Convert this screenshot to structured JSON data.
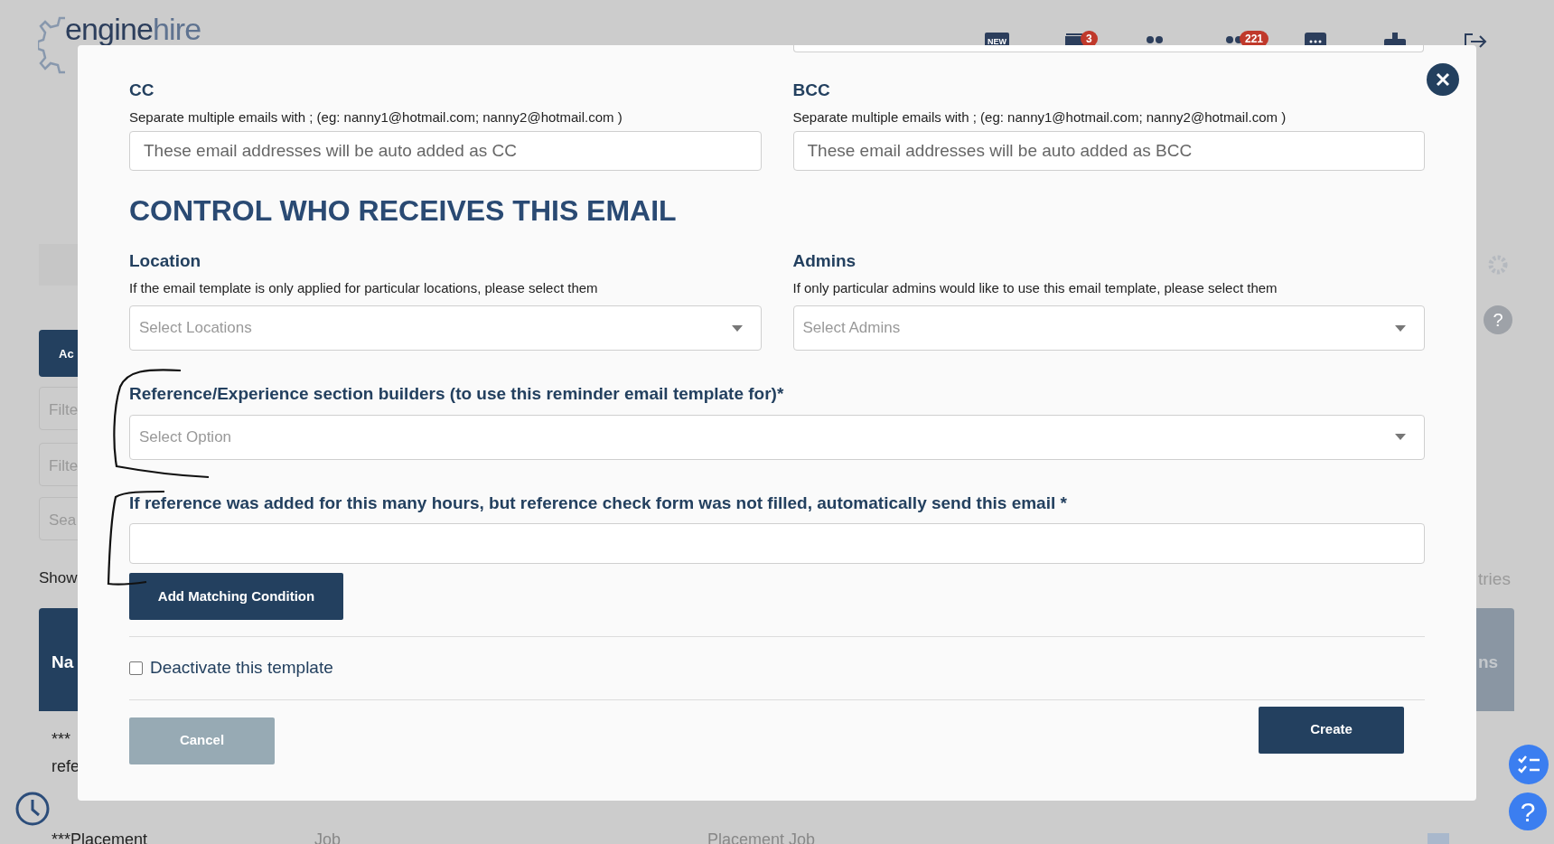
{
  "background": {
    "logo": {
      "word": "engine",
      "suffix": "hire"
    },
    "header_icons": [
      {
        "kind": "new",
        "label": "NEW"
      },
      {
        "kind": "inbox",
        "badge": "3"
      },
      {
        "kind": "people"
      },
      {
        "kind": "people",
        "badge": "221"
      },
      {
        "kind": "chat"
      },
      {
        "kind": "org"
      },
      {
        "kind": "logout"
      }
    ],
    "left_fragments": [
      {
        "kind": "button",
        "text": "Ac"
      },
      {
        "kind": "field",
        "text": "Filte"
      },
      {
        "kind": "field",
        "text": "Filte"
      },
      {
        "kind": "field",
        "text": "Sea"
      },
      {
        "kind": "label",
        "text": "Show"
      },
      {
        "kind": "header",
        "text": "Na"
      },
      {
        "kind": "cell",
        "text": "***"
      },
      {
        "kind": "cell",
        "text": "refe"
      }
    ],
    "right_fragments": [
      {
        "kind": "label",
        "text": "tries"
      },
      {
        "kind": "header",
        "text": "ns"
      }
    ],
    "help_badges": [
      "?",
      "?"
    ],
    "bottom_row": [
      "***Placement",
      "Job",
      "Placement Job"
    ]
  },
  "modal": {
    "cc": {
      "label": "CC",
      "hint": "Separate multiple emails with ; (eg: nanny1@hotmail.com; nanny2@hotmail.com )",
      "placeholder": "These email addresses will be auto added as CC"
    },
    "bcc": {
      "label": "BCC",
      "hint": "Separate multiple emails with ; (eg: nanny1@hotmail.com; nanny2@hotmail.com )",
      "placeholder": "These email addresses will be auto added as BCC"
    },
    "heading": "CONTROL WHO RECEIVES THIS EMAIL",
    "location": {
      "label": "Location",
      "hint": "If the email template is only applied for particular locations, please select them",
      "placeholder": "Select Locations"
    },
    "admins": {
      "label": "Admins",
      "hint": "If only particular admins would like to use this email template, please select them",
      "placeholder": "Select Admins"
    },
    "builders": {
      "label": "Reference/Experience section builders (to use this reminder email template for)*",
      "placeholder": "Select Option"
    },
    "hours": {
      "label": "If reference was added for this many hours, but reference check form was not filled, automatically send this email *"
    },
    "add_button": "Add Matching Condition",
    "deactivate": {
      "label": "Deactivate this template",
      "checked": false
    },
    "cancel": "Cancel",
    "create": "Create"
  }
}
